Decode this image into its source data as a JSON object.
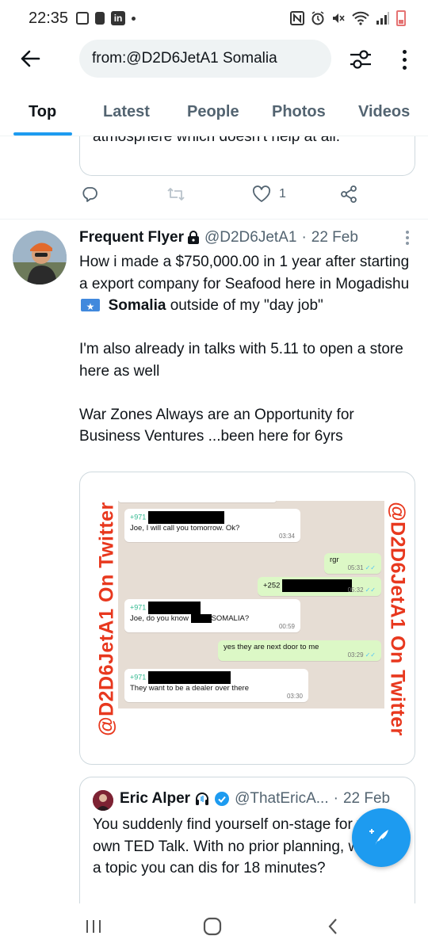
{
  "status_bar": {
    "time": "22:35",
    "left_icons": [
      "gallery-icon",
      "sim-alert-icon",
      "linkedin-icon",
      "dot-icon"
    ],
    "right_icons": [
      "nfc-icon",
      "alarm-icon",
      "mute-icon",
      "wifi-icon",
      "signal-icon",
      "battery-icon"
    ],
    "battery_color": "#e57373"
  },
  "header": {
    "search_query": "from:@D2D6JetA1 Somalia"
  },
  "tabs": [
    {
      "label": "Top",
      "active": true
    },
    {
      "label": "Latest",
      "active": false
    },
    {
      "label": "People",
      "active": false
    },
    {
      "label": "Photos",
      "active": false
    },
    {
      "label": "Videos",
      "active": false
    }
  ],
  "previous_tweet": {
    "quote_text_tail": "atmosphere which doesn't help at all.",
    "like_count": "1"
  },
  "tweet": {
    "display_name": "Frequent Flyer",
    "handle": "@D2D6JetA1",
    "separator": "·",
    "date": "22 Feb",
    "body_line1_pre": "How i made a $750,000.00 in 1 year after starting a export company for Seafood here in Mogadishu",
    "body_line1_bold": "Somalia",
    "body_line1_post": " outside of my \"day job\"",
    "body_para2": "I'm also already in talks with 5.11 to open a store here as well",
    "body_para3": "War Zones Always are an Opportunity for Business Ventures ...been here for 6yrs",
    "media": {
      "watermark": "@D2D6JetA1 On Twitter",
      "messages": [
        {
          "number": "+971",
          "text": "Joe, I will call you tomorrow. Ok?",
          "time": "03:34"
        },
        {
          "text": "rgr",
          "time": "05:31"
        },
        {
          "number": "+252",
          "time": "05:32"
        },
        {
          "number": "+971",
          "text_pre": "Joe, do you know",
          "text_post": "SOMALIA?",
          "time": "00:59"
        },
        {
          "text": "yes they are next door to me",
          "time": "03:29"
        },
        {
          "number": "+971",
          "text": "They want to be a dealer over there",
          "time": "03:30"
        }
      ],
      "colors": {
        "chat_bg": "#e6ddd4",
        "outgoing_bubble": "#dcf8c6",
        "watermark": "#e8381e"
      }
    },
    "quoted": {
      "display_name": "Eric Alper",
      "handle": "@ThatEricA...",
      "separator": "·",
      "date": "22 Feb",
      "body": "You suddenly find yourself on-stage for your own TED Talk. With no prior planning, what's a topic you can dis for 18 minutes?"
    }
  },
  "colors": {
    "accent": "#1d9bf0",
    "text_primary": "#0f1419",
    "text_secondary": "#536471",
    "border": "#cfd9de"
  }
}
